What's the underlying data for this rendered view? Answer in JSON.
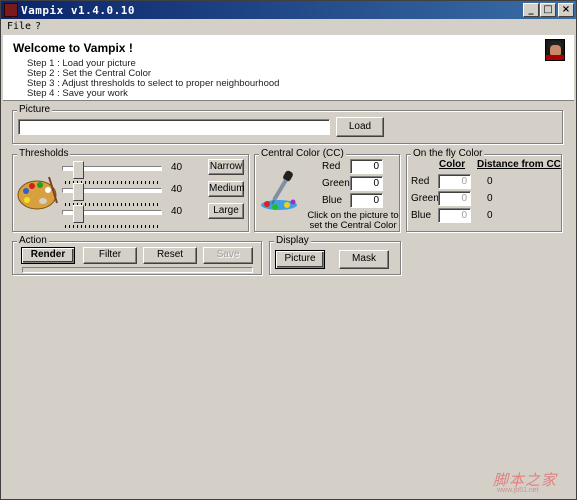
{
  "window": {
    "title": "Vampix v1.4.0.10",
    "minimize_glyph": "_",
    "maximize_glyph": "□",
    "close_glyph": "×"
  },
  "menu": {
    "file": "File",
    "help": "?"
  },
  "welcome": {
    "heading": "Welcome to Vampix !",
    "steps": [
      "Step 1 : Load your picture",
      "Step 2 : Set the Central Color",
      "Step 3 : Adjust thresholds to select to proper neighbourhood",
      "Step 4 : Save your work"
    ]
  },
  "picture": {
    "legend": "Picture",
    "path_value": "",
    "load_button": "Load"
  },
  "thresholds": {
    "legend": "Thresholds",
    "sliders": [
      {
        "value_label": "40",
        "fraction": 0.12
      },
      {
        "value_label": "40",
        "fraction": 0.12
      },
      {
        "value_label": "40",
        "fraction": 0.12
      }
    ],
    "narrow_button": "Narrow",
    "medium_button": "Medium",
    "large_button": "Large"
  },
  "central_color": {
    "legend": "Central Color (CC)",
    "red_label": "Red",
    "green_label": "Green",
    "blue_label": "Blue",
    "red_value": "0",
    "green_value": "0",
    "blue_value": "0",
    "hint": "Click on the picture to set the Central Color"
  },
  "on_the_fly": {
    "legend": "On the fly Color",
    "color_header": "Color",
    "distance_header": "Distance from CC",
    "red_label": "Red",
    "green_label": "Green",
    "blue_label": "Blue",
    "red_value": "0",
    "green_value": "0",
    "blue_value": "0",
    "red_distance": "0",
    "green_distance": "0",
    "blue_distance": "0"
  },
  "action": {
    "legend": "Action",
    "render_button": "Render",
    "filter_button": "Filter",
    "reset_button": "Reset",
    "save_button": "Save",
    "progress": 0
  },
  "display": {
    "legend": "Display",
    "picture_button": "Picture",
    "mask_button": "Mask"
  },
  "watermark": {
    "text": "脚本之家",
    "sub": "www.jb51.net"
  },
  "colors": {
    "titlebar_start": "#0a246a",
    "titlebar_end": "#3a6ea5",
    "face": "#d4d0c8"
  }
}
